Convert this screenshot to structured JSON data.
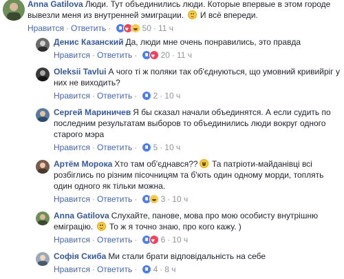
{
  "comments": [
    {
      "author": "Anna Gatilova",
      "text_parts": [
        "Люди. Тут объединились люди. Которые впервые в этом городе вывезли меня из внутренней эмиграции.",
        "И всё впереди."
      ],
      "like": "Нравится",
      "reply": "Ответить",
      "reactions": [
        "like",
        "love",
        "haha"
      ],
      "count": "50",
      "time": "11 ч"
    },
    {
      "author": "Денис Казанский",
      "text_parts": [
        "Да, люди мне очень понравились, это правда"
      ],
      "like": "Нравится",
      "reply": "Ответить",
      "reactions": [
        "like",
        "love"
      ],
      "count": "20",
      "time": "11 ч"
    },
    {
      "author": "Oleksii Tavlui",
      "text_parts": [
        "А чого ті ж поляки так об'єднуються, що умовний кривийріг у них не виходить?"
      ],
      "like": "Нравится",
      "reply": "Ответить",
      "reactions": [
        "like"
      ],
      "count": "2",
      "time": "10 ч"
    },
    {
      "author": "Сергей Мариничев",
      "text_parts": [
        "Я бы сказал начали объединятся. А если судить по последним результатам выборов то объединились люди вокруг одного старого мэра"
      ],
      "like": "Нравится",
      "reply": "Ответить",
      "reactions": [
        "like"
      ],
      "count": "5",
      "time": "10 ч"
    },
    {
      "author": "Артём Морока",
      "text_parts": [
        "Хто там об'єднався??",
        "Та патріоти-майданівці всі розбіглись по різним пісочницям та б'ють один одному морди, топлять один одного як тільки можна."
      ],
      "like": "Нравится",
      "reply": "Ответить",
      "reactions": [
        "like",
        "haha"
      ],
      "count": "3",
      "time": "10 ч"
    },
    {
      "author": "Anna Gatilova",
      "text_parts": [
        "Слухайте, панове, мова про мою особисту внутрішню еміграцію.",
        "То ж я точно знаю, про кого кажу. )"
      ],
      "like": "Нравится",
      "reply": "Ответить",
      "reactions": [
        "like",
        "love"
      ],
      "count": "6",
      "time": "10 ч"
    },
    {
      "author": "Софія Скиба",
      "text_parts": [
        "Ми стали брати відповідальність на себе"
      ],
      "like": "Нравится",
      "reply": "Ответить",
      "reactions": [
        "like"
      ],
      "count": "4",
      "time": "8 ч"
    }
  ],
  "colors": {
    "author": "#365899",
    "link": "#4267b2",
    "meta": "#90949c",
    "text": "#1d2129"
  }
}
